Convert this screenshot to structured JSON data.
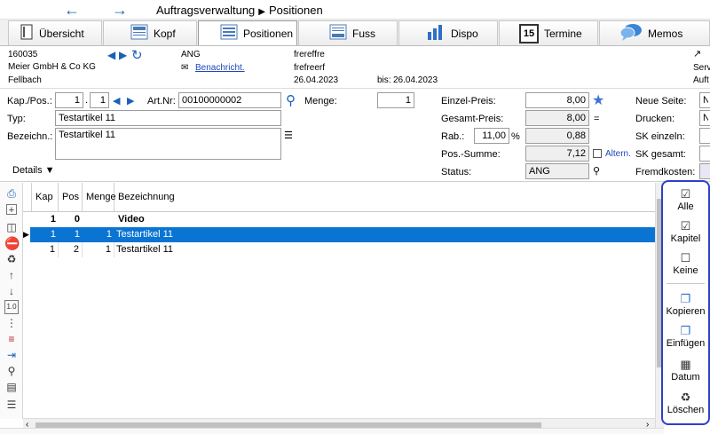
{
  "topbar": {
    "back_icon": "back-arrow-icon",
    "forward_icon": "forward-arrow-icon",
    "breadcrumb_root": "Auftragsverwaltung",
    "breadcrumb_current": "Positionen"
  },
  "tabs": [
    {
      "label": "Übersicht",
      "icon": "document-icon"
    },
    {
      "label": "Kopf",
      "icon": "header-icon"
    },
    {
      "label": "Positionen",
      "icon": "list-icon"
    },
    {
      "label": "Fuss",
      "icon": "footer-icon"
    },
    {
      "label": "Dispo",
      "icon": "bar-chart-icon"
    },
    {
      "label": "Termine",
      "icon": "calendar-icon",
      "day": "15"
    },
    {
      "label": "Memos",
      "icon": "speech-bubble-icon"
    }
  ],
  "header": {
    "order_no": "160035",
    "company": "Meier GmbH & Co KG",
    "city": "Fellbach",
    "status_code": "ANG",
    "notify_link": "Benachricht.",
    "free_text_1": "frereffre",
    "free_text_2": "frefreerf",
    "date_from": "26.04.2023",
    "date_to_label": "bis:",
    "date_to": "26.04.2023",
    "right_cut_1": "Serv",
    "right_cut_2": "Auft"
  },
  "form": {
    "kap_pos_label": "Kap./Pos.:",
    "kap_value": "1",
    "pos_value": "1",
    "art_nr_label": "Art.Nr:",
    "art_nr_value": "00100000002",
    "menge_label": "Menge:",
    "menge_value": "1",
    "typ_label": "Typ:",
    "typ_value": "Testartikel 11",
    "bezeichn_label": "Bezeichn.:",
    "bezeichn_value": "Testartikel 11",
    "details_label": "Details",
    "einzel_preis_label": "Einzel-Preis:",
    "einzel_preis_value": "8,00",
    "gesamt_preis_label": "Gesamt-Preis:",
    "gesamt_preis_value": "8,00",
    "rab_label": "Rab.:",
    "rab_value": "11,00",
    "rab_unit": "%",
    "rab_amount": "0,88",
    "pos_summe_label": "Pos.-Summe:",
    "pos_summe_value": "7,12",
    "altern_label": "Altern.",
    "status_label": "Status:",
    "status_value": "ANG",
    "equals_sign": "=",
    "neue_seite_label": "Neue Seite:",
    "neue_seite_value": "N",
    "drucken_label": "Drucken:",
    "drucken_value": "N",
    "sk_einzeln_label": "SK einzeln:",
    "sk_gesamt_label": "SK gesamt:",
    "fremdkosten_label": "Fremdkosten:"
  },
  "grid": {
    "columns": [
      "Kap",
      "Pos",
      "Menge",
      "Bezeichnung"
    ],
    "rows": [
      {
        "kap": "1",
        "pos": "0",
        "menge": "",
        "bez": "Video",
        "style": "bold"
      },
      {
        "kap": "1",
        "pos": "1",
        "menge": "1",
        "bez": "Testartikel 11",
        "style": "selected"
      },
      {
        "kap": "1",
        "pos": "2",
        "menge": "1",
        "bez": "Testartikel 11",
        "style": "normal"
      }
    ]
  },
  "right_panel": [
    {
      "label": "Alle",
      "icon": "select-all-icon"
    },
    {
      "label": "Kapitel",
      "icon": "checkbox-icon"
    },
    {
      "label": "Keine",
      "icon": "deselect-icon"
    },
    {
      "label": "Kopieren",
      "icon": "copy-icon"
    },
    {
      "label": "Einfügen",
      "icon": "paste-icon"
    },
    {
      "label": "Datum",
      "icon": "calendar-small-icon"
    },
    {
      "label": "Löschen",
      "icon": "trash-icon"
    }
  ],
  "colors": {
    "selection": "#0a74d3",
    "panel_border": "#2e3fc8",
    "link": "#1c47b8"
  }
}
